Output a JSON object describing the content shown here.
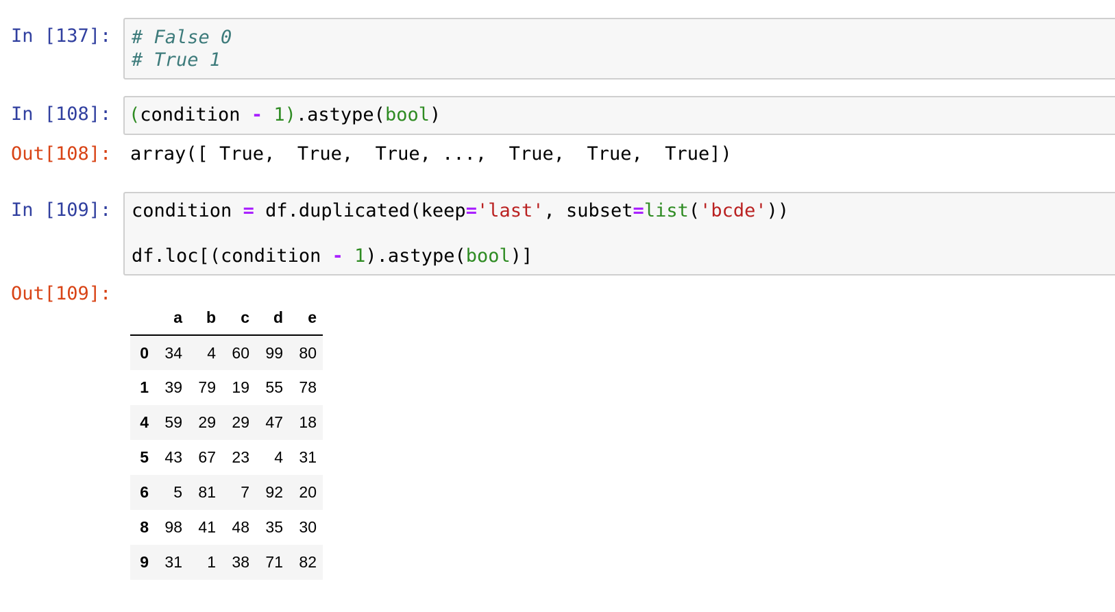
{
  "cells": [
    {
      "in_prompt": "In [137]:",
      "code": [
        [
          "# False 0"
        ],
        [
          "# True 1"
        ]
      ]
    },
    {
      "in_prompt": "In [108]:",
      "code_tokens": [
        "(",
        "condition ",
        "-",
        " ",
        "1",
        ")",
        ".astype(",
        "bool",
        ")"
      ],
      "out_prompt": "Out[108]:",
      "out_text": "array([ True,  True,  True, ...,  True,  True,  True])"
    },
    {
      "in_prompt": "In [109]:",
      "line1_tokens": [
        "condition ",
        "=",
        " df.duplicated(keep",
        "=",
        "'last'",
        ", subset",
        "=",
        "list",
        "(",
        "'bcde'",
        "))"
      ],
      "line2_tokens": [
        "df.loc[(condition ",
        "-",
        " ",
        "1",
        ").astype(",
        "bool",
        ")]"
      ],
      "out_prompt": "Out[109]:"
    }
  ],
  "dataframe": {
    "columns": [
      "",
      "a",
      "b",
      "c",
      "d",
      "e"
    ],
    "rows": [
      {
        "index": "0",
        "values": [
          "34",
          "4",
          "60",
          "99",
          "80"
        ]
      },
      {
        "index": "1",
        "values": [
          "39",
          "79",
          "19",
          "55",
          "78"
        ]
      },
      {
        "index": "4",
        "values": [
          "59",
          "29",
          "29",
          "47",
          "18"
        ]
      },
      {
        "index": "5",
        "values": [
          "43",
          "67",
          "23",
          "4",
          "31"
        ]
      },
      {
        "index": "6",
        "values": [
          "5",
          "81",
          "7",
          "92",
          "20"
        ]
      },
      {
        "index": "8",
        "values": [
          "98",
          "41",
          "48",
          "35",
          "30"
        ]
      },
      {
        "index": "9",
        "values": [
          "31",
          "1",
          "38",
          "71",
          "82"
        ]
      }
    ]
  }
}
